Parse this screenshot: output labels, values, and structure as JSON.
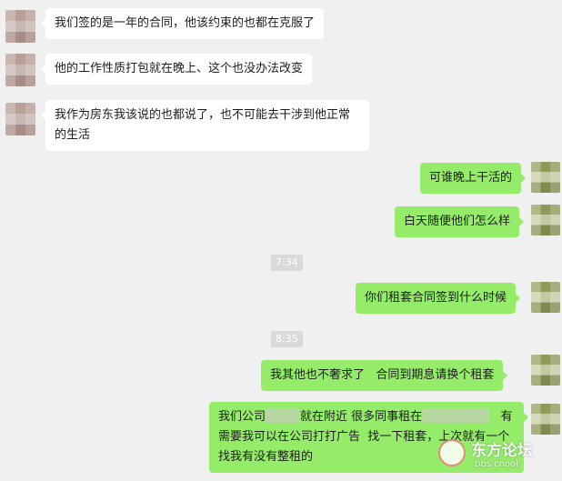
{
  "messages": [
    {
      "side": "left",
      "text": "我们签的是一年的合同，他该约束的也都在克服了"
    },
    {
      "side": "left",
      "text": "他的工作性质打包就在晚上、这个也没办法改变"
    },
    {
      "side": "left",
      "text": "我作为房东我该说的也都说了，也不可能去干涉到他正常的生活"
    },
    {
      "side": "right",
      "text": "可谁晚上干活的"
    },
    {
      "side": "right",
      "text": "白天随便他们怎么样"
    },
    {
      "side": "right",
      "text": "你们租套合同签到什么时候"
    },
    {
      "side": "right",
      "text": "我其他也不奢求了   合同到期息请换个租套"
    },
    {
      "side": "right",
      "text_parts": [
        "我们公司",
        "就在附近 很多同事租在",
        "   有需要我可以在公司打打广告  找一下租套，上次就有一个找我有没有整租的"
      ]
    }
  ],
  "timestamps": [
    "7:34",
    "8:35"
  ],
  "watermark": {
    "name": "东方论坛",
    "url": "bbs.cnool"
  },
  "icons": {
    "avatar_left": "avatar-blurred",
    "avatar_right": "avatar-blurred-green"
  }
}
